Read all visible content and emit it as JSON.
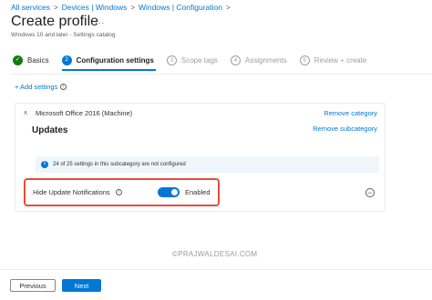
{
  "breadcrumb": {
    "items": [
      "All services",
      "Devices | Windows",
      "Windows | Configuration"
    ],
    "separator": ">"
  },
  "header": {
    "title": "Create profile",
    "more": "...",
    "subtitle": "Windows 10 and later - Settings catalog"
  },
  "steps": [
    {
      "label": "Basics",
      "state": "done",
      "icon": "✓"
    },
    {
      "label": "Configuration settings",
      "state": "active",
      "icon": "2"
    },
    {
      "label": "Scope tags",
      "state": "todo",
      "icon": "3"
    },
    {
      "label": "Assignments",
      "state": "todo",
      "icon": "4"
    },
    {
      "label": "Review + create",
      "state": "todo",
      "icon": "5"
    }
  ],
  "add_settings": {
    "label": "+ Add settings",
    "info_icon": "i"
  },
  "category": {
    "name": "Microsoft Office 2016 (Machine)",
    "remove_label": "Remove category",
    "chevron": "∧"
  },
  "subcategory": {
    "title": "Updates",
    "remove_label": "Remove subcategory"
  },
  "info_bar": {
    "icon": "i",
    "text": "24 of 25 settings in this subcategory are not configured"
  },
  "setting": {
    "label": "Hide Update Notifications",
    "info_icon": "i",
    "toggle_state": "Enabled",
    "toggle_on": true,
    "remove_icon": "−"
  },
  "watermark": "©PRAJWALDESAI.COM",
  "footer": {
    "previous_label": "Previous",
    "next_label": "Next"
  },
  "colors": {
    "accent": "#0078d4",
    "success": "#107c10",
    "highlight_border": "#e84c3d",
    "info_bg": "#eff6fc"
  }
}
